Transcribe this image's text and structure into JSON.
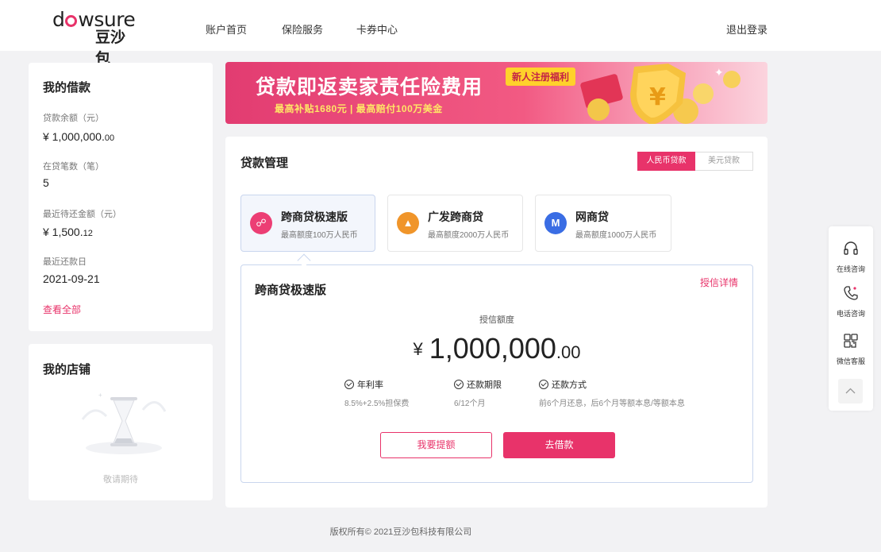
{
  "header": {
    "logo_en": "dowsure",
    "logo_cn": "豆沙包",
    "nav": [
      "账户首页",
      "保险服务",
      "卡券中心"
    ],
    "logout": "退出登录"
  },
  "loan_summary": {
    "title": "我的借款",
    "balance_label": "贷款余额（元）",
    "balance_main": "¥ 1,000,000.",
    "balance_dec": "00",
    "count_label": "在贷笔数（笔）",
    "count_value": "5",
    "due_label": "最近待还金额（元）",
    "due_main": "¥ 1,500.",
    "due_dec": "12",
    "date_label": "最近还款日",
    "date_value": "2021-09-21",
    "view_all": "查看全部"
  },
  "shop": {
    "title": "我的店铺",
    "coming_soon": "敬请期待"
  },
  "banner": {
    "title": "贷款即返卖家责任险费用",
    "subtitle": "最高补贴1680元 | 最高赔付100万美金",
    "badge": "新人注册福利",
    "colors": {
      "start": "#e23c71",
      "end": "#fbd4de",
      "accent": "#ffd12b"
    }
  },
  "loan_management": {
    "title": "贷款管理",
    "currency_tabs": [
      "人民币贷款",
      "美元贷款"
    ],
    "selected_currency": "人民币贷款",
    "products": [
      {
        "name": "跨商贷极速版",
        "desc": "最高额度100万人民币",
        "icon": "link-icon",
        "color": "#ec3e74",
        "glyph": "☍"
      },
      {
        "name": "广发跨商贷",
        "desc": "最高额度2000万人民币",
        "icon": "triangle-icon",
        "color": "#f0952a",
        "glyph": "▲"
      },
      {
        "name": "网商贷",
        "desc": "最高额度1000万人民币",
        "icon": "m-logo-icon",
        "color": "#3a6de4",
        "glyph": "M"
      }
    ],
    "detail": {
      "title": "跨商贷极速版",
      "link": "授信详情",
      "credit_label": "授信额度",
      "currency_symbol": "¥",
      "amount_main": "1,000,000",
      "amount_dec": ".00",
      "terms": [
        {
          "label": "年利率",
          "value": "8.5%+2.5%担保费"
        },
        {
          "label": "还款期限",
          "value": "6/12个月"
        },
        {
          "label": "还款方式",
          "value": "前6个月还息，后6个月等额本息/等额本息"
        }
      ],
      "btn_raise": "我要提额",
      "btn_borrow": "去借款"
    }
  },
  "footer": {
    "text": "版权所有© 2021豆沙包科技有限公司"
  },
  "float_service": {
    "items": [
      {
        "label": "在线咨询",
        "icon": "headset-icon"
      },
      {
        "label": "电话咨询",
        "icon": "phone-icon"
      },
      {
        "label": "微信客服",
        "icon": "qrcode-icon"
      }
    ],
    "back_top_icon": "chevron-up-icon"
  },
  "theme": {
    "accent": "#e8336a",
    "page_bg": "#f2f2f4"
  }
}
